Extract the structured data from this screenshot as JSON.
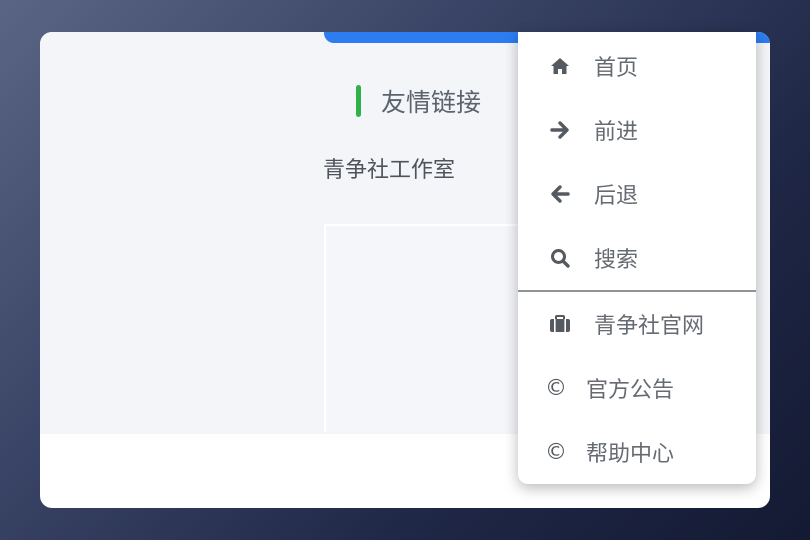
{
  "page": {
    "friend_links_title": "友情链接",
    "studio_link": "青争社工作室"
  },
  "menu": {
    "items": [
      {
        "label": "首页",
        "icon": "home-icon"
      },
      {
        "label": "前进",
        "icon": "arrow-right-icon"
      },
      {
        "label": "后退",
        "icon": "arrow-left-icon"
      },
      {
        "label": "搜索",
        "icon": "search-icon"
      },
      {
        "label": "青争社官网",
        "icon": "briefcase-icon"
      },
      {
        "label": "官方公告",
        "icon": "copyright-icon",
        "glyph": "©"
      },
      {
        "label": "帮助中心",
        "icon": "copyright-icon",
        "glyph": "©"
      }
    ]
  },
  "colors": {
    "accent_blue": "#2d7cf0",
    "accent_green": "#2fb24a"
  }
}
